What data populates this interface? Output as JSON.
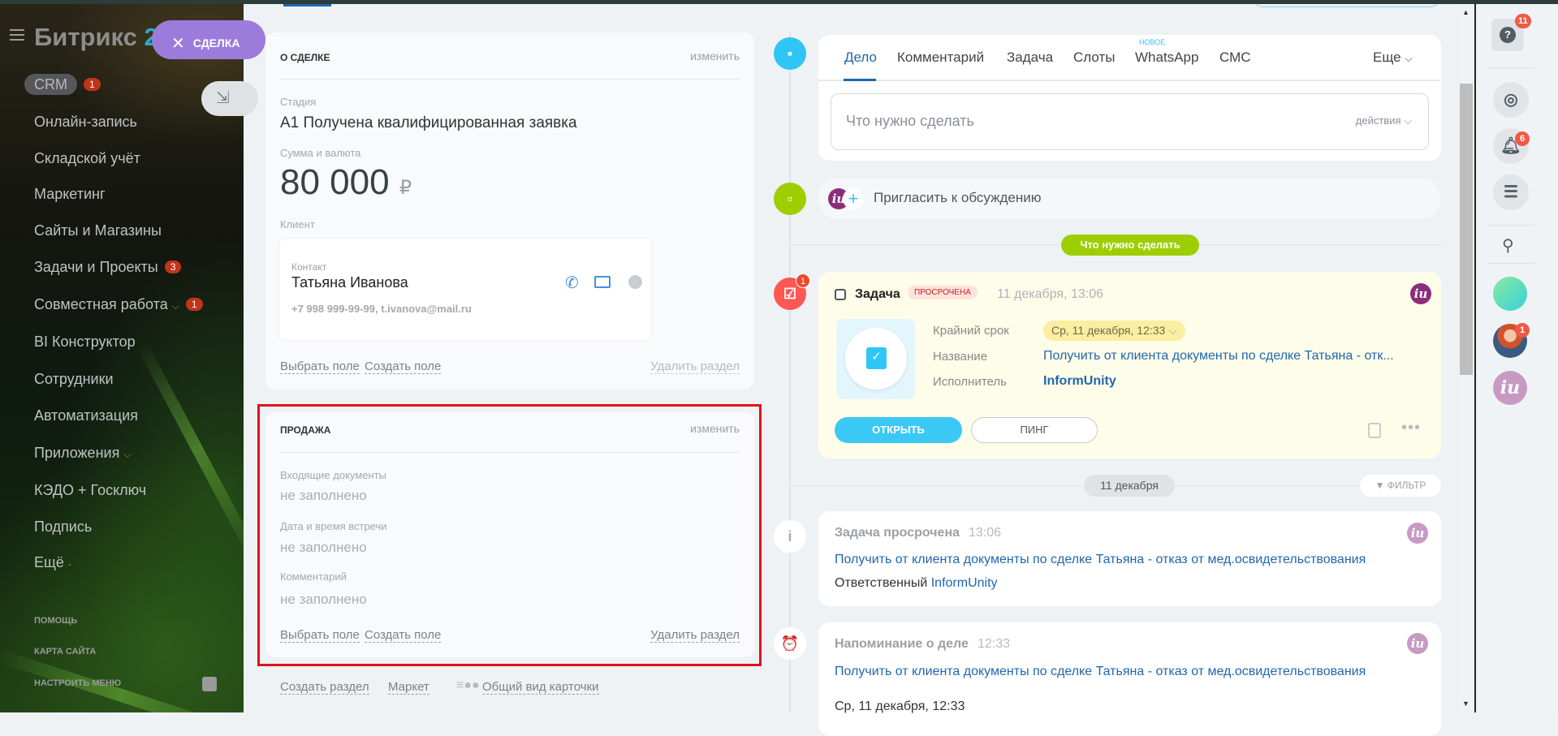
{
  "sidebar": {
    "logo": {
      "name": "Битрикс",
      "suffix": "24"
    },
    "deal_pill": "СДЕЛКА",
    "items": [
      {
        "label": "CRM",
        "badge": "1"
      },
      {
        "label": "Онлайн-запись"
      },
      {
        "label": "Складской учёт"
      },
      {
        "label": "Маркетинг"
      },
      {
        "label": "Сайты и Магазины"
      },
      {
        "label": "Задачи и Проекты",
        "badge": "3"
      },
      {
        "label": "Совместная работа",
        "badge": "1"
      },
      {
        "label": "BI Конструктор"
      },
      {
        "label": "Сотрудники"
      },
      {
        "label": "Автоматизация"
      },
      {
        "label": "Приложения"
      },
      {
        "label": "КЭДО + Госключ"
      },
      {
        "label": "Подпись"
      },
      {
        "label": "Ещё"
      }
    ],
    "footer": {
      "help": "ПОМОЩЬ",
      "sitemap": "КАРТА САЙТА",
      "configure": "НАСТРОИТЬ МЕНЮ"
    }
  },
  "deal": {
    "title": "О СДЕЛКЕ",
    "edit": "изменить",
    "stage_label": "Стадия",
    "stage_value": "А1 Получена квалифицированная заявка",
    "amount_label": "Сумма и валюта",
    "amount": "80 000",
    "currency": "₽",
    "client_label": "Клиент",
    "contact": {
      "label": "Контакт",
      "name": "Татьяна Иванова",
      "details": "+7 998 999-99-99, t.ivanova@mail.ru"
    },
    "select_field": "Выбрать поле",
    "create_field": "Создать поле",
    "delete_section": "Удалить раздел"
  },
  "sale": {
    "title": "ПРОДАЖА",
    "edit": "изменить",
    "fields": [
      {
        "label": "Входящие документы",
        "value": "не заполнено"
      },
      {
        "label": "Дата и время встречи",
        "value": "не заполнено"
      },
      {
        "label": "Комментарий",
        "value": "не заполнено"
      }
    ],
    "select_field": "Выбрать поле",
    "create_field": "Создать поле",
    "delete_section": "Удалить раздел"
  },
  "bottom_links": {
    "create_section": "Создать раздел",
    "market": "Маркет",
    "card_view": "Общий вид карточки"
  },
  "editor": {
    "tabs": [
      "Дело",
      "Комментарий",
      "Задача",
      "Слоты",
      "WhatsApp",
      "СМС"
    ],
    "new_badge": "НОВОЕ",
    "more": "Еще",
    "placeholder": "Что нужно сделать",
    "actions": "действия"
  },
  "invite": "Пригласить к обсуждению",
  "todo_pill": "Что нужно сделать",
  "task": {
    "title": "Задача",
    "status": "ПРОСРОЧЕНА",
    "time": "11 декабря, 13:06",
    "counter": "1",
    "deadline_label": "Крайний срок",
    "deadline": "Ср, 11 декабря, 12:33",
    "name_label": "Название",
    "name": "Получить от клиента документы по сделке Татьяна - отк...",
    "assignee_label": "Исполнитель",
    "assignee": "InformUnity",
    "open": "ОТКРЫТЬ",
    "ping": "ПИНГ"
  },
  "date_divider": "11 декабря",
  "filter": "ФИЛЬТР",
  "events": [
    {
      "title": "Задача просрочена",
      "time": "13:06",
      "link": "Получить от клиента документы по сделке Татьяна - отказ от мед.освидетельствования",
      "resp_label": "Ответственный",
      "resp": "InformUnity"
    },
    {
      "title": "Напоминание о деле",
      "time": "12:33",
      "link": "Получить от клиента документы по сделке Татьяна - отказ от мед.освидетельствования",
      "date": "Ср, 11 декабря, 12:33"
    }
  ],
  "rail": {
    "help_badge": "11",
    "bell_badge": "6",
    "avatar_badge": "1"
  },
  "colors": {
    "accent": "#2fc6f6",
    "deal_pill": "#9c7cdb",
    "todo_green": "#9dcf00",
    "overdue": "#ff5752",
    "link": "#2067b0"
  }
}
